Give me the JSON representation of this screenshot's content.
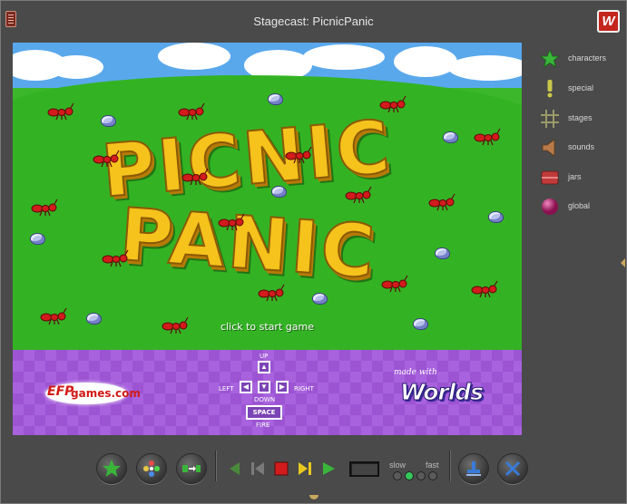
{
  "window": {
    "title": "Stagecast: PicnicPanic",
    "badge": "W"
  },
  "stage": {
    "logo_line1": "PICNIC",
    "logo_line2": "PANIC",
    "start_prompt": "click to start game",
    "efp_mark": "EFP",
    "efp_text": "games.com",
    "controls": {
      "up": "UP",
      "down": "DOWN",
      "left": "LEFT",
      "right": "RIGHT",
      "space": "SPACE",
      "fire": "FIRE"
    },
    "made_with": "made with",
    "worlds": "Worlds"
  },
  "tools": [
    {
      "label": "characters",
      "icon": "star-icon"
    },
    {
      "label": "special",
      "icon": "exclamation-icon"
    },
    {
      "label": "stages",
      "icon": "grid-icon"
    },
    {
      "label": "sounds",
      "icon": "speaker-icon"
    },
    {
      "label": "jars",
      "icon": "jar-icon"
    },
    {
      "label": "global",
      "icon": "ball-icon"
    }
  ],
  "toolbar": {
    "speed_slow": "slow",
    "speed_fast": "fast",
    "speed_level": 2,
    "speed_levels": 4
  },
  "colors": {
    "window_bg": "#4a4a4a",
    "grass": "#33b323",
    "sky": "#5aa8ec",
    "purple_banner": "#9c54d3",
    "logo_yellow": "#f6c21c",
    "ant_red": "#d21b1b",
    "speed_on": "#35c85b"
  }
}
